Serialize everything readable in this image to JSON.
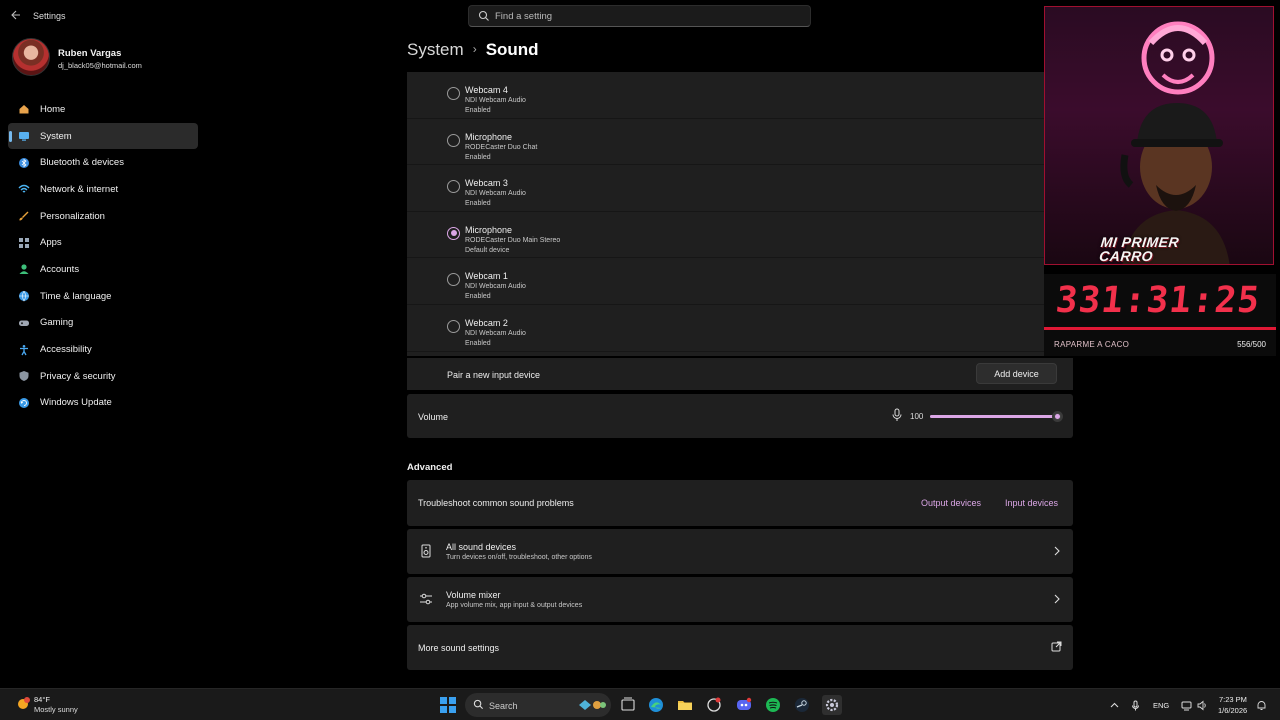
{
  "window": {
    "app_title": "Settings"
  },
  "search": {
    "placeholder": "Find a setting"
  },
  "user": {
    "name": "Ruben Vargas",
    "email": "dj_black05@hotmail.com"
  },
  "sidebar": {
    "items": [
      {
        "label": "Home",
        "icon": "home-icon",
        "color": "#e9a34c",
        "active": false
      },
      {
        "label": "System",
        "icon": "system-icon",
        "color": "#58b0f0",
        "active": true
      },
      {
        "label": "Bluetooth & devices",
        "icon": "bluetooth-icon",
        "color": "#3a8de0",
        "active": false
      },
      {
        "label": "Network & internet",
        "icon": "wifi-icon",
        "color": "#4ab2f0",
        "active": false
      },
      {
        "label": "Personalization",
        "icon": "brush-icon",
        "color": "#e8a23a",
        "active": false
      },
      {
        "label": "Apps",
        "icon": "apps-icon",
        "color": "#9aa8b8",
        "active": false
      },
      {
        "label": "Accounts",
        "icon": "accounts-icon",
        "color": "#3dbf7a",
        "active": false
      },
      {
        "label": "Time & language",
        "icon": "globe-icon",
        "color": "#3a9be8",
        "active": false
      },
      {
        "label": "Gaming",
        "icon": "gaming-icon",
        "color": "#a0a8b4",
        "active": false
      },
      {
        "label": "Accessibility",
        "icon": "accessibility-icon",
        "color": "#4aa8f0",
        "active": false
      },
      {
        "label": "Privacy & security",
        "icon": "shield-icon",
        "color": "#8c96a2",
        "active": false
      },
      {
        "label": "Windows Update",
        "icon": "update-icon",
        "color": "#3a9be8",
        "active": false
      }
    ]
  },
  "header": {
    "parent": "System",
    "separator": "›",
    "current": "Sound"
  },
  "input_devices": [
    {
      "name": "Webcam 4",
      "source": "NDI Webcam Audio",
      "status": "Enabled",
      "selected": false
    },
    {
      "name": "Microphone",
      "source": "RODECaster Duo Chat",
      "status": "Enabled",
      "selected": false
    },
    {
      "name": "Webcam 3",
      "source": "NDI Webcam Audio",
      "status": "Enabled",
      "selected": false
    },
    {
      "name": "Microphone",
      "source": "RODECaster Duo Main Stereo",
      "status": "Default device",
      "selected": true
    },
    {
      "name": "Webcam 1",
      "source": "NDI Webcam Audio",
      "status": "Enabled",
      "selected": false
    },
    {
      "name": "Webcam 2",
      "source": "NDI Webcam Audio",
      "status": "Enabled",
      "selected": false
    }
  ],
  "pair": {
    "label": "Pair a new input device",
    "button": "Add device"
  },
  "volume": {
    "label": "Volume",
    "value": "100",
    "level": 1.0
  },
  "advanced": {
    "title": "Advanced",
    "troubleshoot": {
      "label": "Troubleshoot common sound problems",
      "output_link": "Output devices",
      "input_link": "Input devices"
    },
    "all_devices": {
      "title": "All sound devices",
      "subtitle": "Turn devices on/off, troubleshoot, other options"
    },
    "mixer": {
      "title": "Volume mixer",
      "subtitle": "App volume mix, app input & output devices"
    },
    "more": {
      "label": "More sound settings"
    }
  },
  "overlay": {
    "banner": "MI PRIMER CARRO",
    "timer": "331:31:25",
    "caption": "RAPARME A CACO",
    "count": "556/500"
  },
  "taskbar": {
    "weather_temp": "84°F",
    "weather_condition": "Mostly sunny",
    "search_label": "Search",
    "language": "ENG",
    "time": "7:23 PM",
    "date": "1/6/2026"
  },
  "colors": {
    "accent": "#dba6e6",
    "timer_red": "#f2304b"
  }
}
